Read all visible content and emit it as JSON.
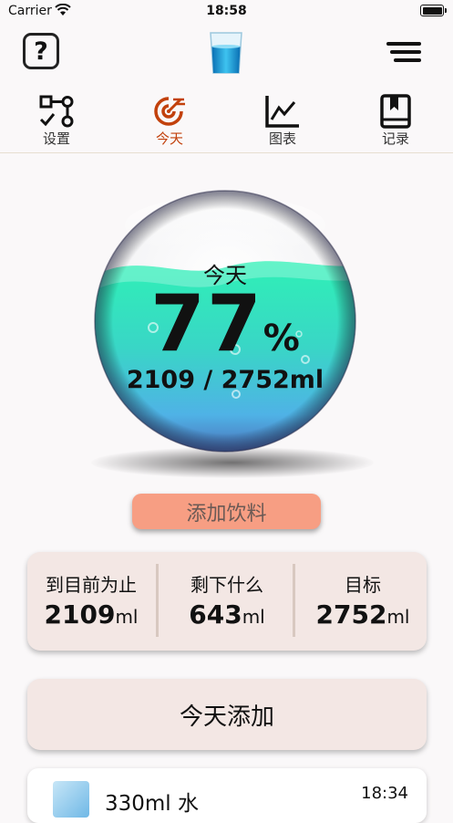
{
  "status_bar": {
    "carrier": "Carrier",
    "time": "18:58"
  },
  "nav": {
    "help_label": "?"
  },
  "tabs": [
    {
      "label": "设置",
      "icon": "settings-flow-icon"
    },
    {
      "label": "今天",
      "icon": "today-target-icon",
      "active": true
    },
    {
      "label": "图表",
      "icon": "chart-icon"
    },
    {
      "label": "记录",
      "icon": "records-book-icon"
    }
  ],
  "progress": {
    "label": "今天",
    "percent": "77",
    "percent_sign": "%",
    "amount": "2109 / 2752ml",
    "fill_fraction": 0.77
  },
  "add_drink_label": "添加饮料",
  "stats": [
    {
      "title": "到目前为止",
      "value": "2109",
      "unit": "ml"
    },
    {
      "title": "剩下什么",
      "value": "643",
      "unit": "ml"
    },
    {
      "title": "目标",
      "value": "2752",
      "unit": "ml"
    }
  ],
  "today_added_label": "今天添加",
  "entries": [
    {
      "name": "330ml 水",
      "time": "18:34"
    }
  ],
  "colors": {
    "accent": "#c2410c",
    "button": "#f79e83",
    "card": "#f3e7e4",
    "water": "#2ee6b0"
  }
}
